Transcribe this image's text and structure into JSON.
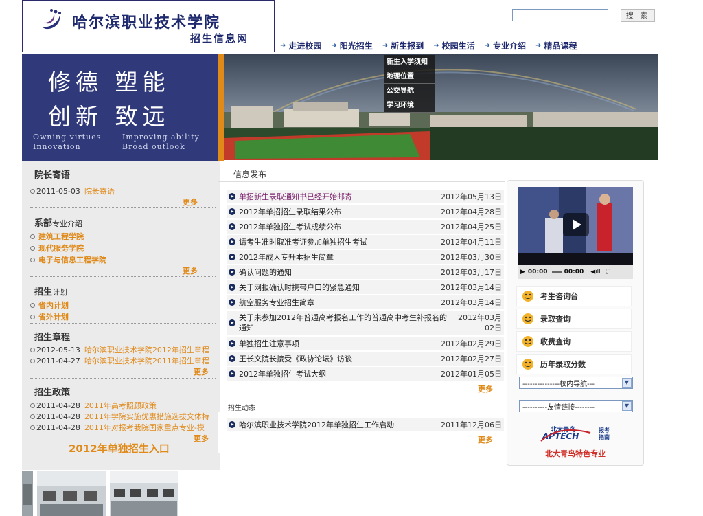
{
  "header": {
    "logo_title": "哈尔滨职业技术学院",
    "logo_subtitle": "招生信息网",
    "search_placeholder": "",
    "search_button": "搜 索"
  },
  "nav": [
    {
      "label": "走进校园"
    },
    {
      "label": "阳光招生"
    },
    {
      "label": "新生报到"
    },
    {
      "label": "校园生活"
    },
    {
      "label": "专业介绍"
    },
    {
      "label": "精品课程"
    }
  ],
  "banner": {
    "motto_line1": "修德 塑能",
    "motto_line2": "创新 致远",
    "motto_en_1a": "Owning virtues",
    "motto_en_1b": "Improving ability",
    "motto_en_2a": "Innovation",
    "motto_en_2b": "Broad outlook",
    "dropdown_items": [
      "新生入学须知",
      "地理位置",
      "公交导航",
      "学习环境"
    ]
  },
  "left": {
    "president": {
      "title": "院长寄语",
      "items": [
        {
          "date": "2011-05-03",
          "text": "院长寄语"
        }
      ],
      "more": "更多"
    },
    "departments": {
      "title_main": "系部",
      "title_small": "专业介绍",
      "items": [
        "建筑工程学院",
        "现代服务学院",
        "电子与信息工程学院"
      ],
      "more": "更多"
    },
    "plan": {
      "title_main": "招生",
      "title_small": "计划",
      "items": [
        "省内计划",
        "省外计划"
      ]
    },
    "charter": {
      "title": "招生章程",
      "items": [
        {
          "date": "2012-05-13",
          "text": "哈尔滨职业技术学院2012年招生章程"
        },
        {
          "date": "2011-04-27",
          "text": "哈尔滨职业技术学院2011年招生章程"
        }
      ],
      "more": "更多"
    },
    "policy": {
      "title": "招生政策",
      "items": [
        {
          "date": "2011-04-28",
          "text": "2011年高考照顾政策"
        },
        {
          "date": "2011-04-28",
          "text": "2011年学院实施优惠措施选拔文体特"
        },
        {
          "date": "2011-04-28",
          "text": "2011年对报考我院国家重点专业-模"
        }
      ],
      "more": "更多"
    },
    "enroll_link": "2012年单独招生入口"
  },
  "news": {
    "title": "信息发布",
    "items": [
      {
        "text": "单招新生录取通知书已经开始邮寄",
        "date": "2012年05月13日"
      },
      {
        "text": "2012年单招招生录取结果公布",
        "date": "2012年04月28日"
      },
      {
        "text": "2012年单独招生考试成绩公布",
        "date": "2012年04月25日"
      },
      {
        "text": "请考生准时取准考证参加单独招生考试",
        "date": "2012年04月11日"
      },
      {
        "text": "2012年成人专升本招生简章",
        "date": "2012年03月30日"
      },
      {
        "text": "确认问题的通知",
        "date": "2012年03月17日"
      },
      {
        "text": "关于网报确认时携带户口的紧急通知",
        "date": "2012年03月14日"
      },
      {
        "text": "航空服务专业招生简章",
        "date": "2012年03月14日"
      },
      {
        "text": "关于未参加2012年普通高考报名工作的普通高中考生补报名的通知",
        "date": "2012年03月02日"
      },
      {
        "text": "单独招生注意事项",
        "date": "2012年02月29日"
      },
      {
        "text": "王长文院长接受《政协论坛》访谈",
        "date": "2012年02月27日"
      },
      {
        "text": "2012年单独招生考试大纲",
        "date": "2012年01月05日"
      }
    ],
    "more": "更多"
  },
  "dynamics": {
    "title": "招生动态",
    "items": [
      {
        "text": "哈尔滨职业技术学院2012年单独招生工作启动",
        "date": "2011年12月06日"
      }
    ],
    "more": "更多"
  },
  "right": {
    "video_time_current": "00:00",
    "video_time_total": "00:00",
    "services": [
      "考生咨询台",
      "录取查询",
      "收费查询",
      "历年录取分数"
    ],
    "nav_select": "---------------校内导航---",
    "links_select": "----------友情链接--------",
    "aptech_cn": "北大青鸟",
    "aptech_en": "APTECH",
    "aptech_tag": "报考指南",
    "aptech_bottom": "北大青鸟特色专业"
  },
  "colors": {
    "navy": "#303a7a",
    "accent_orange": "#e08a1a",
    "link_purple": "#7a1f6a"
  }
}
